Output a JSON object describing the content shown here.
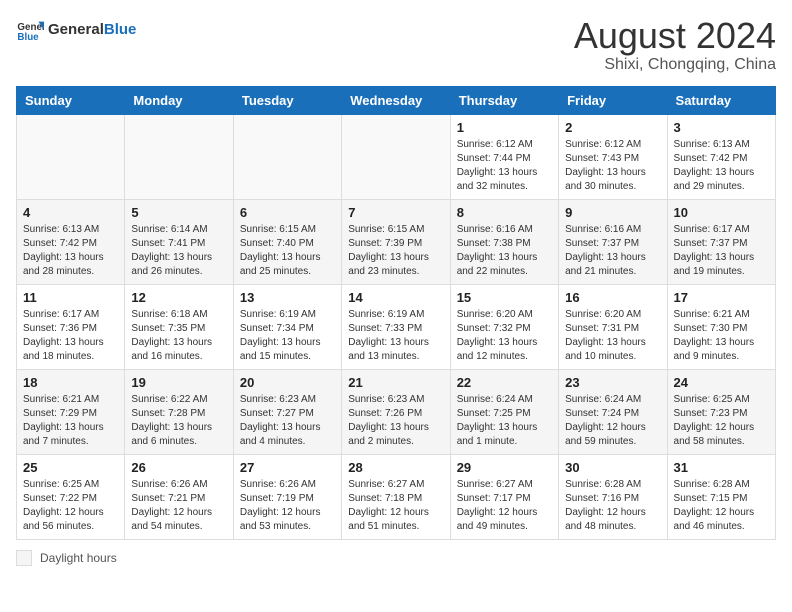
{
  "header": {
    "logo_general": "General",
    "logo_blue": "Blue",
    "month_year": "August 2024",
    "location": "Shixi, Chongqing, China"
  },
  "weekdays": [
    "Sunday",
    "Monday",
    "Tuesday",
    "Wednesday",
    "Thursday",
    "Friday",
    "Saturday"
  ],
  "weeks": [
    [
      {
        "day": "",
        "sunrise": "",
        "sunset": "",
        "daylight": ""
      },
      {
        "day": "",
        "sunrise": "",
        "sunset": "",
        "daylight": ""
      },
      {
        "day": "",
        "sunrise": "",
        "sunset": "",
        "daylight": ""
      },
      {
        "day": "",
        "sunrise": "",
        "sunset": "",
        "daylight": ""
      },
      {
        "day": "1",
        "sunrise": "Sunrise: 6:12 AM",
        "sunset": "Sunset: 7:44 PM",
        "daylight": "Daylight: 13 hours and 32 minutes."
      },
      {
        "day": "2",
        "sunrise": "Sunrise: 6:12 AM",
        "sunset": "Sunset: 7:43 PM",
        "daylight": "Daylight: 13 hours and 30 minutes."
      },
      {
        "day": "3",
        "sunrise": "Sunrise: 6:13 AM",
        "sunset": "Sunset: 7:42 PM",
        "daylight": "Daylight: 13 hours and 29 minutes."
      }
    ],
    [
      {
        "day": "4",
        "sunrise": "Sunrise: 6:13 AM",
        "sunset": "Sunset: 7:42 PM",
        "daylight": "Daylight: 13 hours and 28 minutes."
      },
      {
        "day": "5",
        "sunrise": "Sunrise: 6:14 AM",
        "sunset": "Sunset: 7:41 PM",
        "daylight": "Daylight: 13 hours and 26 minutes."
      },
      {
        "day": "6",
        "sunrise": "Sunrise: 6:15 AM",
        "sunset": "Sunset: 7:40 PM",
        "daylight": "Daylight: 13 hours and 25 minutes."
      },
      {
        "day": "7",
        "sunrise": "Sunrise: 6:15 AM",
        "sunset": "Sunset: 7:39 PM",
        "daylight": "Daylight: 13 hours and 23 minutes."
      },
      {
        "day": "8",
        "sunrise": "Sunrise: 6:16 AM",
        "sunset": "Sunset: 7:38 PM",
        "daylight": "Daylight: 13 hours and 22 minutes."
      },
      {
        "day": "9",
        "sunrise": "Sunrise: 6:16 AM",
        "sunset": "Sunset: 7:37 PM",
        "daylight": "Daylight: 13 hours and 21 minutes."
      },
      {
        "day": "10",
        "sunrise": "Sunrise: 6:17 AM",
        "sunset": "Sunset: 7:37 PM",
        "daylight": "Daylight: 13 hours and 19 minutes."
      }
    ],
    [
      {
        "day": "11",
        "sunrise": "Sunrise: 6:17 AM",
        "sunset": "Sunset: 7:36 PM",
        "daylight": "Daylight: 13 hours and 18 minutes."
      },
      {
        "day": "12",
        "sunrise": "Sunrise: 6:18 AM",
        "sunset": "Sunset: 7:35 PM",
        "daylight": "Daylight: 13 hours and 16 minutes."
      },
      {
        "day": "13",
        "sunrise": "Sunrise: 6:19 AM",
        "sunset": "Sunset: 7:34 PM",
        "daylight": "Daylight: 13 hours and 15 minutes."
      },
      {
        "day": "14",
        "sunrise": "Sunrise: 6:19 AM",
        "sunset": "Sunset: 7:33 PM",
        "daylight": "Daylight: 13 hours and 13 minutes."
      },
      {
        "day": "15",
        "sunrise": "Sunrise: 6:20 AM",
        "sunset": "Sunset: 7:32 PM",
        "daylight": "Daylight: 13 hours and 12 minutes."
      },
      {
        "day": "16",
        "sunrise": "Sunrise: 6:20 AM",
        "sunset": "Sunset: 7:31 PM",
        "daylight": "Daylight: 13 hours and 10 minutes."
      },
      {
        "day": "17",
        "sunrise": "Sunrise: 6:21 AM",
        "sunset": "Sunset: 7:30 PM",
        "daylight": "Daylight: 13 hours and 9 minutes."
      }
    ],
    [
      {
        "day": "18",
        "sunrise": "Sunrise: 6:21 AM",
        "sunset": "Sunset: 7:29 PM",
        "daylight": "Daylight: 13 hours and 7 minutes."
      },
      {
        "day": "19",
        "sunrise": "Sunrise: 6:22 AM",
        "sunset": "Sunset: 7:28 PM",
        "daylight": "Daylight: 13 hours and 6 minutes."
      },
      {
        "day": "20",
        "sunrise": "Sunrise: 6:23 AM",
        "sunset": "Sunset: 7:27 PM",
        "daylight": "Daylight: 13 hours and 4 minutes."
      },
      {
        "day": "21",
        "sunrise": "Sunrise: 6:23 AM",
        "sunset": "Sunset: 7:26 PM",
        "daylight": "Daylight: 13 hours and 2 minutes."
      },
      {
        "day": "22",
        "sunrise": "Sunrise: 6:24 AM",
        "sunset": "Sunset: 7:25 PM",
        "daylight": "Daylight: 13 hours and 1 minute."
      },
      {
        "day": "23",
        "sunrise": "Sunrise: 6:24 AM",
        "sunset": "Sunset: 7:24 PM",
        "daylight": "Daylight: 12 hours and 59 minutes."
      },
      {
        "day": "24",
        "sunrise": "Sunrise: 6:25 AM",
        "sunset": "Sunset: 7:23 PM",
        "daylight": "Daylight: 12 hours and 58 minutes."
      }
    ],
    [
      {
        "day": "25",
        "sunrise": "Sunrise: 6:25 AM",
        "sunset": "Sunset: 7:22 PM",
        "daylight": "Daylight: 12 hours and 56 minutes."
      },
      {
        "day": "26",
        "sunrise": "Sunrise: 6:26 AM",
        "sunset": "Sunset: 7:21 PM",
        "daylight": "Daylight: 12 hours and 54 minutes."
      },
      {
        "day": "27",
        "sunrise": "Sunrise: 6:26 AM",
        "sunset": "Sunset: 7:19 PM",
        "daylight": "Daylight: 12 hours and 53 minutes."
      },
      {
        "day": "28",
        "sunrise": "Sunrise: 6:27 AM",
        "sunset": "Sunset: 7:18 PM",
        "daylight": "Daylight: 12 hours and 51 minutes."
      },
      {
        "day": "29",
        "sunrise": "Sunrise: 6:27 AM",
        "sunset": "Sunset: 7:17 PM",
        "daylight": "Daylight: 12 hours and 49 minutes."
      },
      {
        "day": "30",
        "sunrise": "Sunrise: 6:28 AM",
        "sunset": "Sunset: 7:16 PM",
        "daylight": "Daylight: 12 hours and 48 minutes."
      },
      {
        "day": "31",
        "sunrise": "Sunrise: 6:28 AM",
        "sunset": "Sunset: 7:15 PM",
        "daylight": "Daylight: 12 hours and 46 minutes."
      }
    ]
  ],
  "footer": {
    "legend_label": "Daylight hours"
  }
}
